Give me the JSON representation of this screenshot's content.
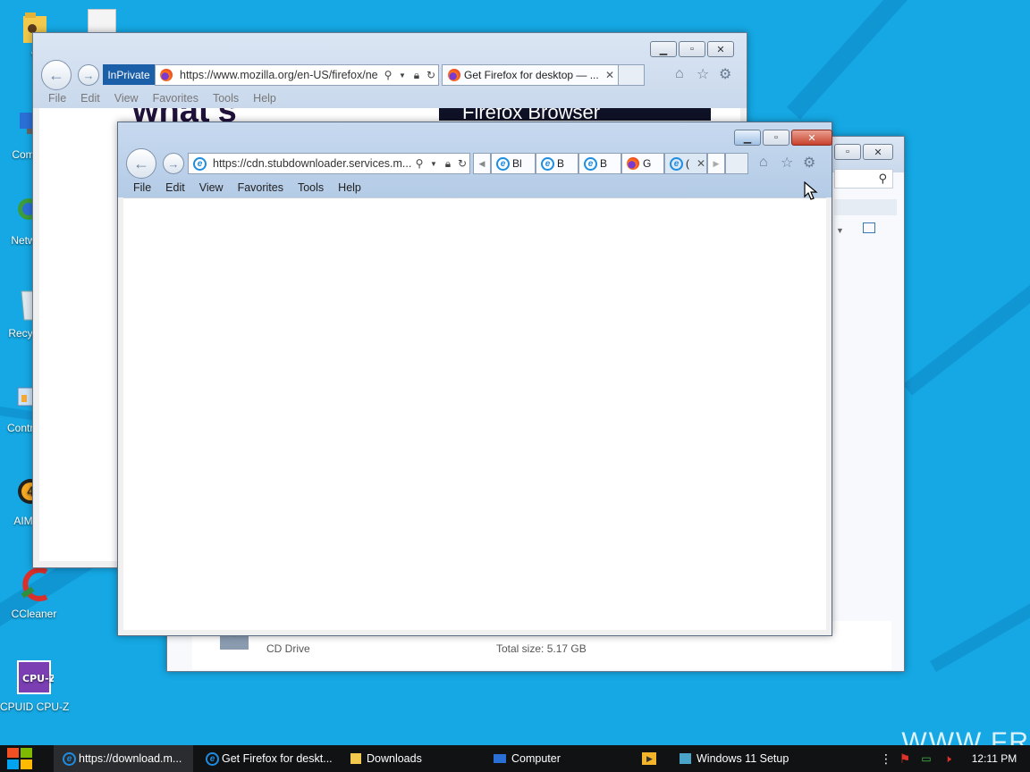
{
  "desktop": {
    "icons": [
      {
        "label": "VM",
        "icon": "folder-user-icon"
      },
      {
        "label": "Com",
        "icon": "computer-icon"
      },
      {
        "label": "Netw",
        "icon": "network-icon"
      },
      {
        "label": "Recyc",
        "icon": "recycle-bin-icon"
      },
      {
        "label": "Contro",
        "icon": "control-panel-icon"
      },
      {
        "label": "AIM",
        "icon": "aimp-icon"
      },
      {
        "label": "CCleaner",
        "icon": "ccleaner-icon"
      },
      {
        "label": "CPUID CPU-Z",
        "icon": "cpuz-icon"
      }
    ],
    "watermark": "WWW.FR"
  },
  "back_window": {
    "inprivate": "InPrivate",
    "address": "https://www.mozilla.org/en-US/firefox/ne",
    "tab_title": "Get Firefox for desktop — ...",
    "menu": [
      "File",
      "Edit",
      "View",
      "Favorites",
      "Tools",
      "Help"
    ],
    "page_heading": "what's",
    "banner_text": "Firefox Browser"
  },
  "explorer_window": {
    "drive_label": "CD Drive",
    "total_size": "Total size:  5.17 GB"
  },
  "front_window": {
    "address": "https://cdn.stubdownloader.services.m...",
    "tabs": [
      {
        "label": "Bl",
        "icon": "ie-icon"
      },
      {
        "label": "B",
        "icon": "ie-icon"
      },
      {
        "label": "B",
        "icon": "ie-icon"
      },
      {
        "label": "G",
        "icon": "firefox-icon"
      },
      {
        "label": "(",
        "icon": "ie-icon"
      }
    ],
    "menu": [
      "File",
      "Edit",
      "View",
      "Favorites",
      "Tools",
      "Help"
    ]
  },
  "taskbar": {
    "items": [
      {
        "label": "https://download.m...",
        "icon": "ie-icon"
      },
      {
        "label": "Get Firefox for deskt...",
        "icon": "ie-icon"
      },
      {
        "label": "Downloads",
        "icon": "folder-icon"
      },
      {
        "label": "Computer",
        "icon": "computer-icon"
      },
      {
        "label": "",
        "icon": "media-player-icon"
      },
      {
        "label": "Windows 11 Setup",
        "icon": "setup-icon"
      }
    ],
    "clock": "12:11 PM"
  }
}
